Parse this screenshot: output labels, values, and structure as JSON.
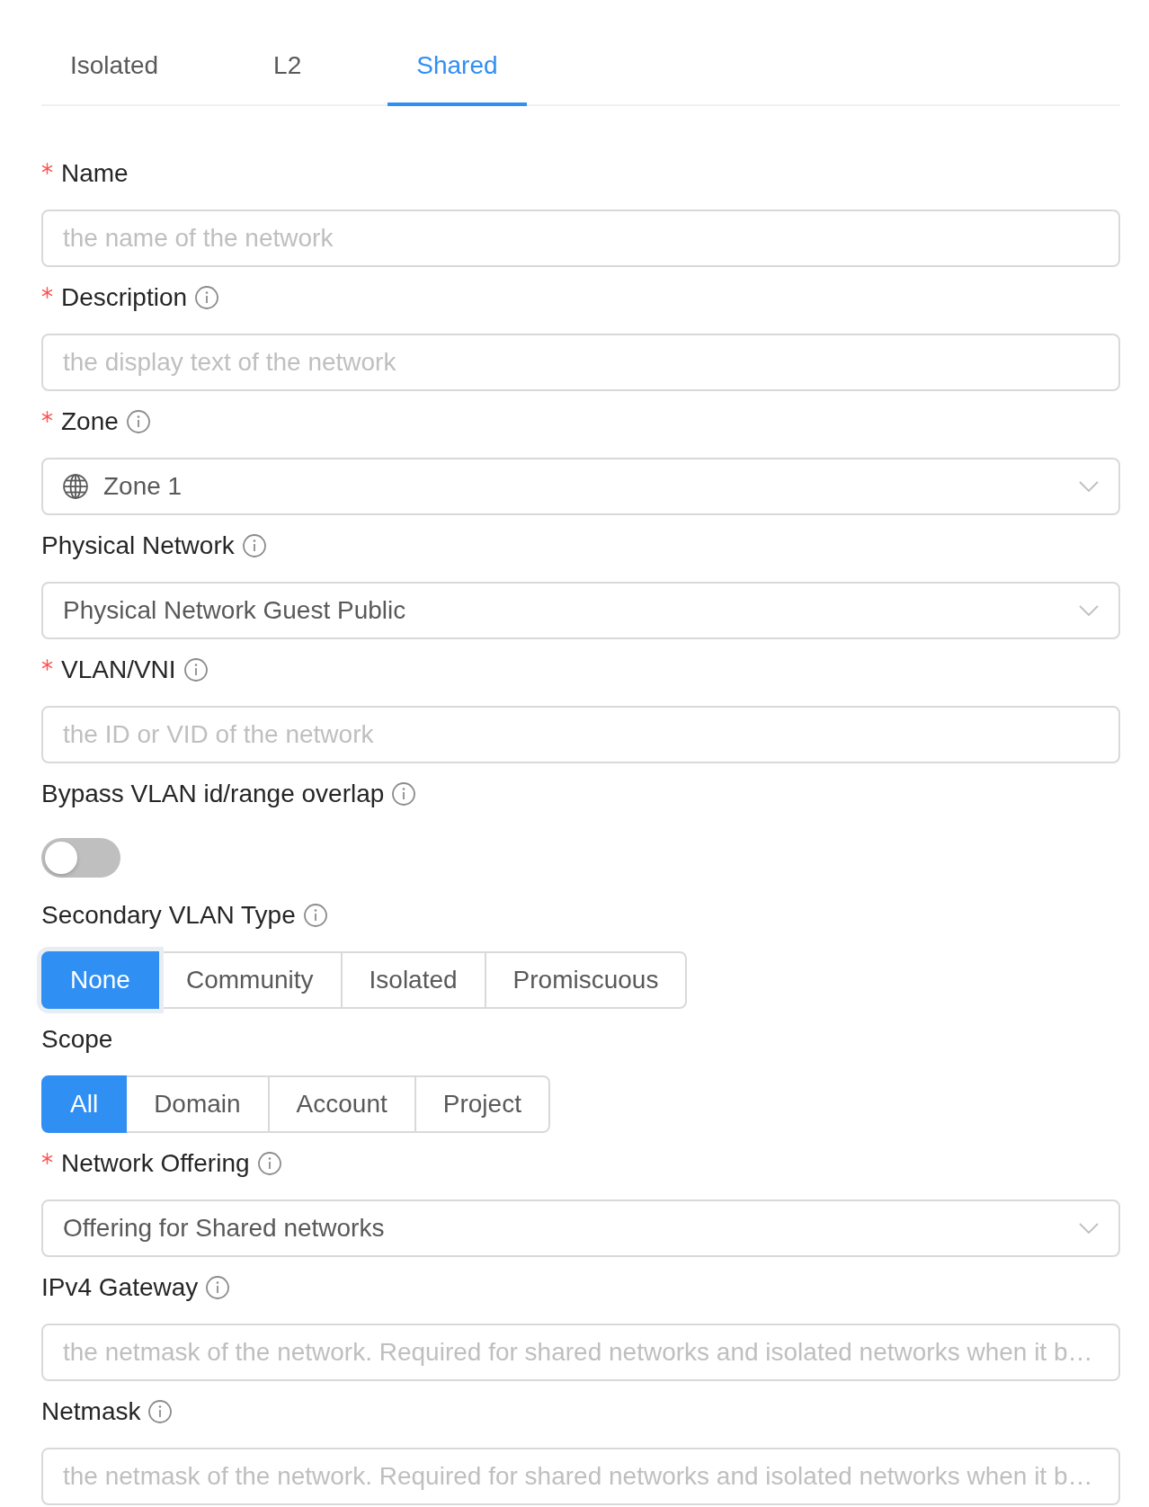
{
  "tabs": [
    {
      "label": "Isolated",
      "selected": false
    },
    {
      "label": "L2",
      "selected": false
    },
    {
      "label": "Shared",
      "selected": true
    }
  ],
  "form": {
    "fields": [
      {
        "kind": "input",
        "label": "Name",
        "required": true,
        "info": false,
        "placeholder": "the name of the network"
      },
      {
        "kind": "input",
        "label": "Description",
        "required": true,
        "info": true,
        "placeholder": "the display text of the network"
      },
      {
        "kind": "select",
        "label": "Zone",
        "required": true,
        "info": true,
        "icon": true,
        "value": "Zone 1"
      },
      {
        "kind": "select",
        "label": "Physical Network",
        "required": false,
        "info": true,
        "value": "Physical Network Guest Public"
      },
      {
        "kind": "input",
        "label": "VLAN/VNI",
        "required": true,
        "info": true,
        "placeholder": "the ID or VID of the network"
      },
      {
        "kind": "switch",
        "label": "Bypass VLAN id/range overlap",
        "required": false,
        "info": true,
        "on": false
      },
      {
        "kind": "radio",
        "label": "Secondary VLAN Type",
        "required": false,
        "info": true,
        "options": [
          {
            "label": "None",
            "selected": true,
            "focused": true
          },
          {
            "label": "Community",
            "selected": false,
            "focused": false
          },
          {
            "label": "Isolated",
            "selected": false,
            "focused": false
          },
          {
            "label": "Promiscuous",
            "selected": false,
            "focused": false
          }
        ]
      },
      {
        "kind": "radio",
        "label": "Scope",
        "required": false,
        "info": false,
        "options": [
          {
            "label": "All",
            "selected": true,
            "focused": false
          },
          {
            "label": "Domain",
            "selected": false,
            "focused": false
          },
          {
            "label": "Account",
            "selected": false,
            "focused": false
          },
          {
            "label": "Project",
            "selected": false,
            "focused": false
          }
        ]
      },
      {
        "kind": "select",
        "label": "Network Offering",
        "required": true,
        "info": true,
        "value": "Offering for Shared networks"
      },
      {
        "kind": "input",
        "label": "IPv4 Gateway",
        "required": false,
        "info": true,
        "placeholder": "the netmask of the network. Required for shared networks and isolated networks when it b…"
      },
      {
        "kind": "input",
        "label": "Netmask",
        "required": false,
        "info": true,
        "placeholder": "the netmask of the network. Required for shared networks and isolated networks when it b…"
      }
    ]
  }
}
